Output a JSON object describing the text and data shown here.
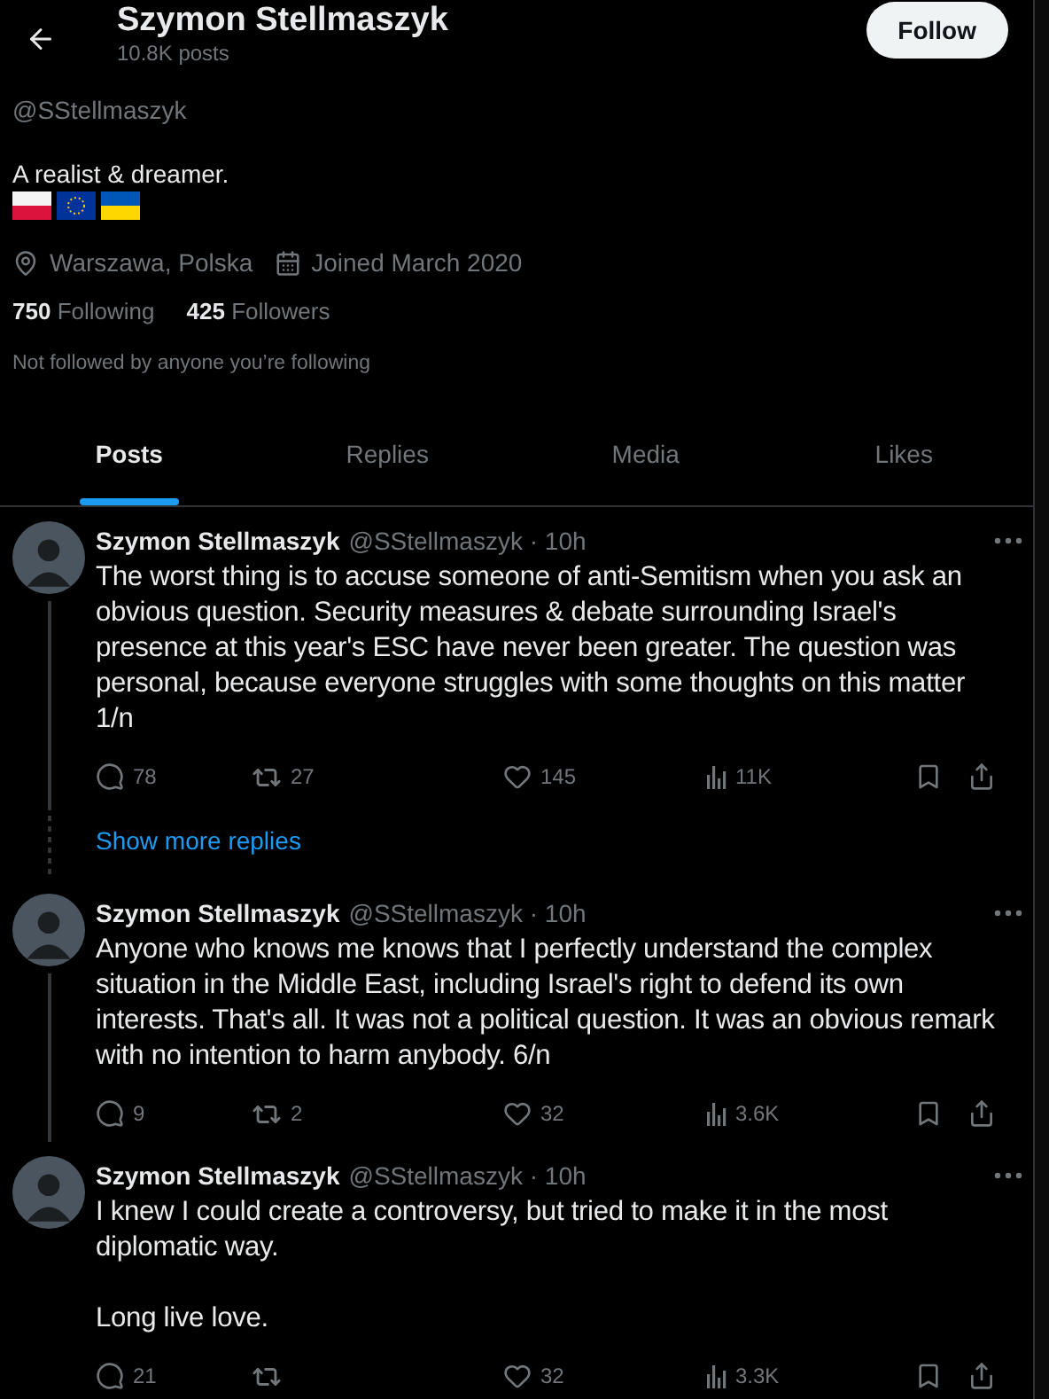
{
  "header": {
    "name": "Szymon Stellmaszyk",
    "posts_count": "10.8K posts",
    "follow_button": "Follow"
  },
  "profile": {
    "handle": "@SStellmaszyk",
    "bio": "A realist & dreamer.",
    "location": "Warszawa, Polska",
    "joined": "Joined March 2020",
    "following_count": "750",
    "following_label": "Following",
    "followers_count": "425",
    "followers_label": "Followers",
    "mutuals_note": "Not followed by anyone you’re following"
  },
  "tabs": [
    {
      "label": "Posts",
      "selected": true
    },
    {
      "label": "Replies",
      "selected": false
    },
    {
      "label": "Media",
      "selected": false
    },
    {
      "label": "Likes",
      "selected": false
    }
  ],
  "timeline": [
    {
      "kind": "post",
      "author": "Szymon Stellmaszyk",
      "meta": "@SStellmaszyk · 10h",
      "text": "The worst thing is to accuse someone of anti-Semitism when you ask an obvious question. Security measures & debate surrounding Israel's presence at this year's ESC have never been greater. The question was personal, because everyone struggles with some thoughts on this matter 1/n",
      "thread_below": true,
      "stats": {
        "replies": "78",
        "reposts": "27",
        "likes": "145",
        "views": "11K"
      }
    },
    {
      "kind": "more",
      "label": "Show more replies"
    },
    {
      "kind": "post",
      "author": "Szymon Stellmaszyk",
      "meta": "@SStellmaszyk · 10h",
      "text": "Anyone who knows me knows that I perfectly understand the complex situation in the Middle East, including Israel's right to defend its own interests. That's all. It was not a political question. It was an obvious remark with no intention to harm anybody. 6/n",
      "thread_below": true,
      "stats": {
        "replies": "9",
        "reposts": "2",
        "likes": "32",
        "views": "3.6K"
      }
    },
    {
      "kind": "post",
      "author": "Szymon Stellmaszyk",
      "meta": "@SStellmaszyk · 10h",
      "text": "I knew I could create a controversy, but tried to make it in the most diplomatic way.\n\nLong live love.",
      "thread_below": false,
      "stats": {
        "replies": "21",
        "likes": "32",
        "views": "3.3K"
      }
    }
  ]
}
